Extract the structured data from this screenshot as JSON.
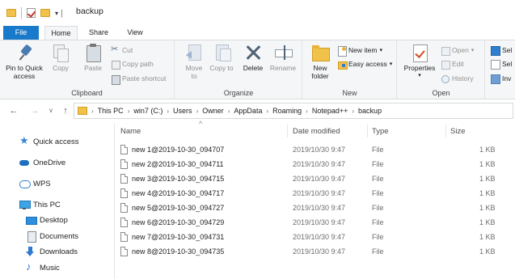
{
  "titlebar": {
    "title": "backup",
    "qat_dropdown": "▾ │"
  },
  "tabs": {
    "file": "File",
    "home": "Home",
    "share": "Share",
    "view": "View"
  },
  "ribbon": {
    "clipboard": {
      "label": "Clipboard",
      "pin": "Pin to Quick access",
      "copy": "Copy",
      "paste": "Paste",
      "cut": "Cut",
      "copy_path": "Copy path",
      "paste_shortcut": "Paste shortcut"
    },
    "organize": {
      "label": "Organize",
      "move_to": "Move to",
      "copy_to": "Copy to",
      "delete": "Delete",
      "rename": "Rename"
    },
    "new": {
      "label": "New",
      "new_folder": "New folder",
      "new_item": "New item",
      "easy_access": "Easy access"
    },
    "open": {
      "label": "Open",
      "properties": "Properties",
      "open": "Open",
      "edit": "Edit",
      "history": "History"
    },
    "select": {
      "item1": "Sel",
      "item2": "Sel",
      "item3": "Inv"
    }
  },
  "nav": {
    "back": "←",
    "forward": "→",
    "recent": "∨",
    "up": "↑"
  },
  "address": {
    "separator": "›",
    "crumbs": [
      "This PC",
      "win7 (C:)",
      "Users",
      "Owner",
      "AppData",
      "Roaming",
      "Notepad++",
      "backup"
    ]
  },
  "sidebar": {
    "items": [
      {
        "label": "Quick access",
        "icon": "star-icon"
      },
      {
        "label": "OneDrive",
        "icon": "cloud-icon"
      },
      {
        "label": "WPS",
        "icon": "wps-cloud-icon"
      },
      {
        "label": "This PC",
        "icon": "computer-icon"
      },
      {
        "label": "Desktop",
        "icon": "desktop-icon"
      },
      {
        "label": "Documents",
        "icon": "documents-icon"
      },
      {
        "label": "Downloads",
        "icon": "download-icon"
      },
      {
        "label": "Music",
        "icon": "music-icon"
      }
    ]
  },
  "columns": {
    "name": "Name",
    "date": "Date modified",
    "type": "Type",
    "size": "Size",
    "sort_caret": "^"
  },
  "files": [
    {
      "name": "new 1@2019-10-30_094707",
      "date": "2019/10/30 9:47",
      "type": "File",
      "size": "1 KB"
    },
    {
      "name": "new 2@2019-10-30_094711",
      "date": "2019/10/30 9:47",
      "type": "File",
      "size": "1 KB"
    },
    {
      "name": "new 3@2019-10-30_094715",
      "date": "2019/10/30 9:47",
      "type": "File",
      "size": "1 KB"
    },
    {
      "name": "new 4@2019-10-30_094717",
      "date": "2019/10/30 9:47",
      "type": "File",
      "size": "1 KB"
    },
    {
      "name": "new 5@2019-10-30_094727",
      "date": "2019/10/30 9:47",
      "type": "File",
      "size": "1 KB"
    },
    {
      "name": "new 6@2019-10-30_094729",
      "date": "2019/10/30 9:47",
      "type": "File",
      "size": "1 KB"
    },
    {
      "name": "new 7@2019-10-30_094731",
      "date": "2019/10/30 9:47",
      "type": "File",
      "size": "1 KB"
    },
    {
      "name": "new 8@2019-10-30_094735",
      "date": "2019/10/30 9:47",
      "type": "File",
      "size": "1 KB"
    }
  ],
  "colors": {
    "accent": "#1979ca",
    "folder": "#f1c24a"
  }
}
